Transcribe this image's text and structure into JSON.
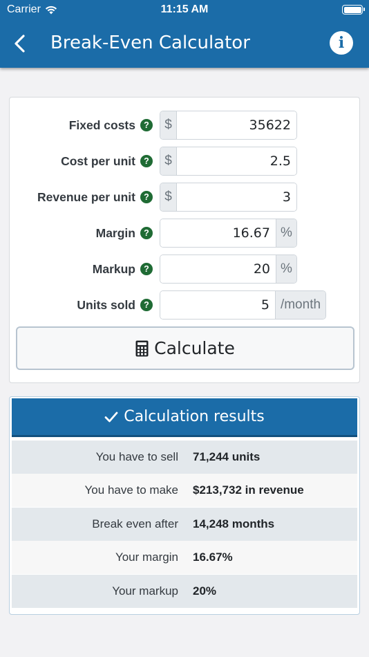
{
  "status_bar": {
    "carrier": "Carrier",
    "time": "11:15 AM"
  },
  "nav": {
    "title": "Break-Even Calculator",
    "info_symbol": "i"
  },
  "form": {
    "fixed_costs": {
      "label": "Fixed costs",
      "prefix": "$",
      "value": "35622"
    },
    "cost_per_unit": {
      "label": "Cost per unit",
      "prefix": "$",
      "value": "2.5"
    },
    "revenue_per_unit": {
      "label": "Revenue per unit",
      "prefix": "$",
      "value": "3"
    },
    "margin": {
      "label": "Margin",
      "value": "16.67",
      "suffix": "%"
    },
    "markup": {
      "label": "Markup",
      "value": "20",
      "suffix": "%"
    },
    "units_sold": {
      "label": "Units sold",
      "value": "5",
      "suffix": "/month"
    },
    "help_symbol": "?",
    "calculate_label": "Calculate"
  },
  "results": {
    "title": "Calculation results",
    "rows": [
      {
        "label": "You have to sell",
        "value": "71,244 units"
      },
      {
        "label": "You have to make",
        "value": "$213,732 in revenue"
      },
      {
        "label": "Break even after",
        "value": "14,248 months"
      },
      {
        "label": "Your margin",
        "value": "16.67%"
      },
      {
        "label": "Your markup",
        "value": "20%"
      }
    ]
  },
  "colors": {
    "brand": "#1b6ca8",
    "help_badge": "#1f6b34",
    "row_shade": "#e3e8ec"
  },
  "icons": [
    "wifi-icon",
    "battery-icon",
    "back-chevron-icon",
    "info-icon",
    "help-icon",
    "calculator-icon",
    "checkmark-icon"
  ]
}
